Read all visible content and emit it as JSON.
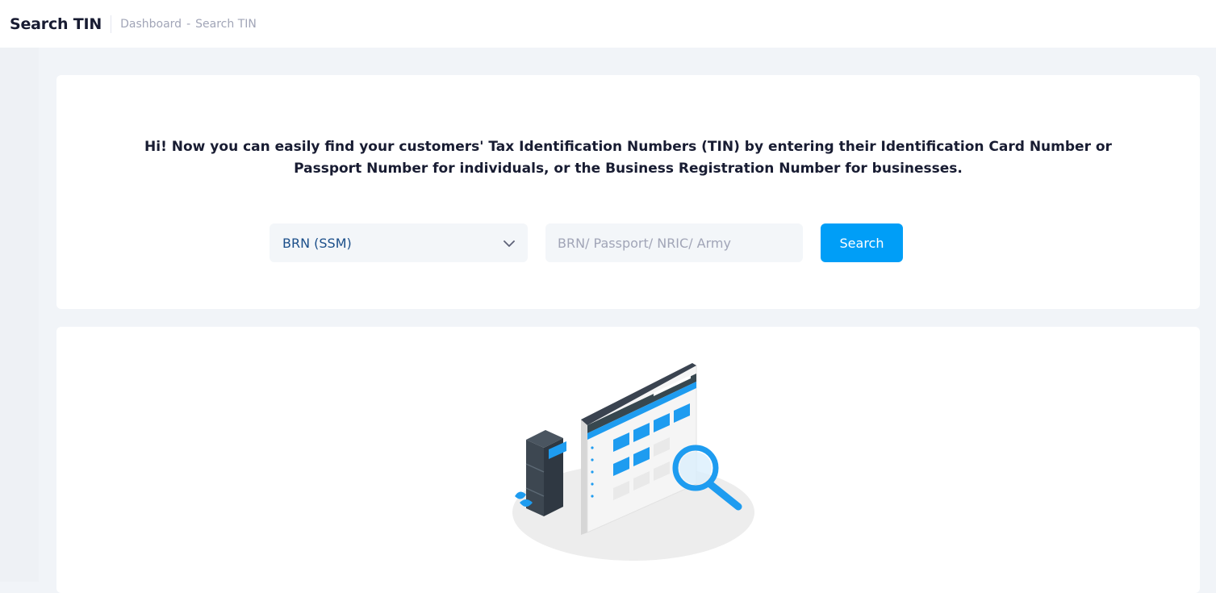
{
  "header": {
    "title": "Search TIN",
    "breadcrumb": {
      "items": [
        "Dashboard",
        "Search TIN"
      ],
      "separator": "-"
    }
  },
  "search": {
    "intro_line1": "Hi! Now you can easily find your customers' Tax Identification Numbers (TIN) by entering their Identification Card Number or",
    "intro_line2": "Passport Number for individuals, or the Business Registration Number for businesses.",
    "id_type": {
      "selected": "BRN (SSM)"
    },
    "id_input": {
      "value": "",
      "placeholder": "BRN/ Passport/ NRIC/ Army"
    },
    "button_label": "Search"
  },
  "illustration": {
    "icon": "search-documents-illustration"
  },
  "colors": {
    "accent": "#009ef7",
    "title_text": "#181c32",
    "muted_text": "#a1a5b7",
    "background": "#f1f4f8",
    "input_background": "#f3f6f9"
  }
}
